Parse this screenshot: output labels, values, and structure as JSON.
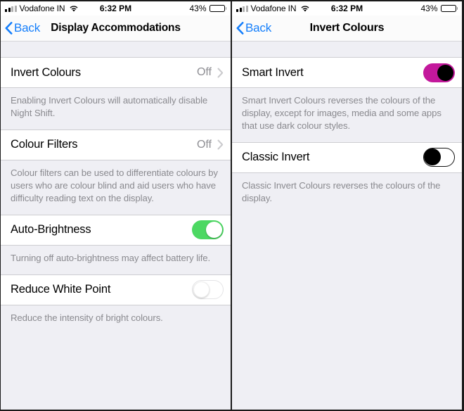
{
  "statusbar": {
    "carrier": "Vodafone IN",
    "time": "6:32 PM",
    "battery_percent": "43%",
    "battery_level": 43,
    "signal_icon": "cellular-bars-icon",
    "wifi_icon": "wifi-icon",
    "battery_icon": "battery-icon"
  },
  "left_screen": {
    "nav": {
      "back_label": "Back",
      "back_icon": "chevron-left-icon",
      "title": "Display Accommodations"
    },
    "rows": [
      {
        "label": "Invert Colours",
        "value": "Off",
        "type": "disclosure",
        "chevron_icon": "chevron-right-icon",
        "footer": "Enabling Invert Colours will automatically disable Night Shift."
      },
      {
        "label": "Colour Filters",
        "value": "Off",
        "type": "disclosure",
        "chevron_icon": "chevron-right-icon",
        "footer": "Colour filters can be used to differentiate colours by users who are colour blind and aid users who have difficulty reading text on the display."
      },
      {
        "label": "Auto-Brightness",
        "type": "switch",
        "switch_state": "on",
        "switch_style": "green",
        "footer": "Turning off auto-brightness may affect battery life."
      },
      {
        "label": "Reduce White Point",
        "type": "switch",
        "switch_state": "off",
        "switch_style": "plain",
        "footer": "Reduce the intensity of bright colours."
      }
    ]
  },
  "right_screen": {
    "nav": {
      "back_label": "Back",
      "back_icon": "chevron-left-icon",
      "title": "Invert Colours"
    },
    "rows": [
      {
        "label": "Smart Invert",
        "type": "switch",
        "switch_state": "on",
        "switch_style": "inverted",
        "footer": "Smart Invert Colours reverses the colours of the display, except for images, media and some apps that use dark colour styles."
      },
      {
        "label": "Classic Invert",
        "type": "switch",
        "switch_state": "off",
        "switch_style": "inverted",
        "footer": "Classic Invert Colours reverses the colours of the display."
      }
    ]
  },
  "colors": {
    "accent_blue": "#147efb",
    "switch_on_green": "#4cd862",
    "switch_inverted_magenta": "#c3189c",
    "list_background": "#efeff4",
    "row_background": "#ffffff",
    "secondary_text": "#8a8a8f"
  }
}
